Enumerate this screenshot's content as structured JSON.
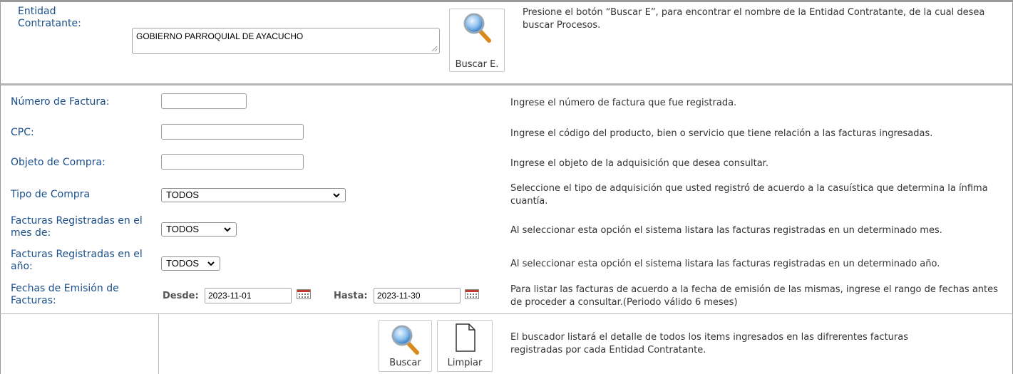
{
  "entidad": {
    "label": "Entidad Contratante:",
    "value": "GOBIERNO PARROQUIAL DE AYACUCHO",
    "button_label": "Buscar E.",
    "help": "Presione el botón “Buscar E”, para encontrar el nombre de la Entidad Contratante, de la cual desea buscar Procesos."
  },
  "fields": {
    "numero_factura": {
      "label": "Número de Factura:",
      "value": "",
      "help": "Ingrese el número de factura que fue registrada."
    },
    "cpc": {
      "label": "CPC:",
      "value": "",
      "help": "Ingrese el código del producto, bien o servicio que tiene relación a las facturas ingresadas."
    },
    "objeto_compra": {
      "label": "Objeto de Compra:",
      "value": "",
      "help": "Ingrese el objeto de la adquisición que desea consultar."
    },
    "tipo_compra": {
      "label": "Tipo de Compra",
      "selected": "TODOS",
      "help": "Seleccione el tipo de adquisición que usted registró de acuerdo a la casuística que determina la ínfima cuantía."
    },
    "mes": {
      "label": "Facturas Registradas en el mes de:",
      "selected": "TODOS",
      "help": "Al seleccionar esta opción el sistema listara las facturas registradas en un determinado mes."
    },
    "anio": {
      "label": "Facturas Registradas en el año:",
      "selected": "TODOS",
      "help": "Al seleccionar esta opción el sistema listara las facturas registradas en un determinado año."
    },
    "fechas": {
      "label": "Fechas de Emisión de Facturas:",
      "desde_label": "Desde:",
      "desde_value": "2023-11-01",
      "hasta_label": "Hasta:",
      "hasta_value": "2023-11-30",
      "help": "Para listar las facturas de acuerdo a la fecha de emisión de las mismas, ingrese el rango de fechas antes de proceder a consultar.(Periodo válido 6 meses)"
    }
  },
  "actions": {
    "buscar_label": "Buscar",
    "limpiar_label": "Limpiar",
    "help": "El buscador listará el detalle de todos los items ingresados en las difrerentes facturas registradas por cada Entidad Contratante."
  },
  "icons": {
    "search": "magnifier-icon",
    "calendar": "calendar-icon",
    "document": "blank-document-icon",
    "chevron": "chevron-down-icon"
  }
}
